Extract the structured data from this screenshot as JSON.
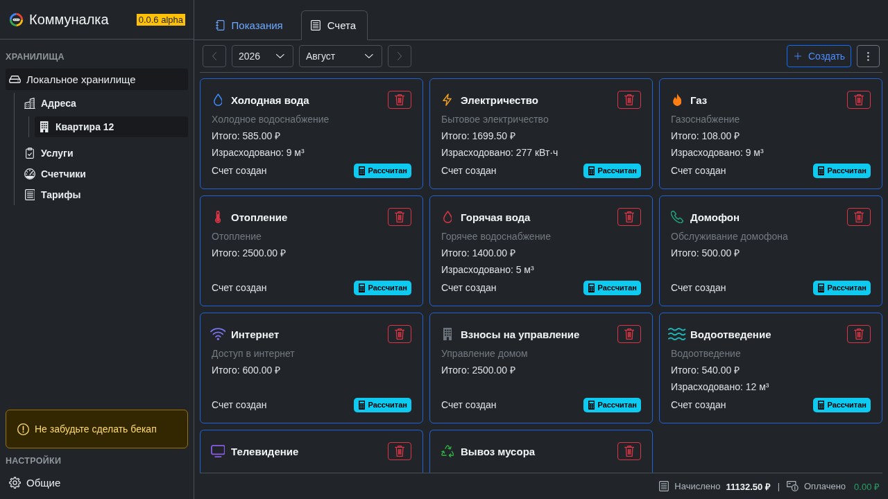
{
  "app": {
    "title": "Коммуналка",
    "version": "0.0.6 alpha"
  },
  "sidebar": {
    "storage_heading": "ХРАНИЛИЩА",
    "tree": [
      {
        "label": "Локальное хранилище",
        "kind": "storage",
        "selected": true,
        "children": [
          {
            "label": "Адреса",
            "kind": "addresses",
            "selected": false,
            "children": [
              {
                "label": "Квартира 12",
                "kind": "apartment",
                "selected": true
              }
            ]
          },
          {
            "label": "Услуги",
            "kind": "services",
            "selected": false
          },
          {
            "label": "Счетчики",
            "kind": "meters",
            "selected": false
          },
          {
            "label": "Тарифы",
            "kind": "tariffs",
            "selected": false
          }
        ]
      }
    ],
    "alert": "Не забудьте сделать бекап",
    "settings_heading": "НАСТРОЙКИ",
    "settings_items": [
      {
        "label": "Общие",
        "kind": "general",
        "selected": false
      }
    ]
  },
  "tabs": [
    {
      "label": "Показания",
      "kind": "readings",
      "selected": false
    },
    {
      "label": "Счета",
      "kind": "bills",
      "selected": true
    }
  ],
  "toolbar": {
    "year": "2026",
    "month": "Август",
    "create_label": "Создать"
  },
  "bills": [
    {
      "kind": "water",
      "color": "#3d8bfd",
      "title": "Холодная вода",
      "service": "Холодное водоснабжение",
      "total": "Итого: 585.00 ₽",
      "consumed": "Израсходовано: 9 м³",
      "status": "Счет создан",
      "badge": "Рассчитан"
    },
    {
      "kind": "electricity",
      "color": "#f0a020",
      "title": "Электричество",
      "service": "Бытовое электричество",
      "total": "Итого: 1699.50 ₽",
      "consumed": "Израсходовано: 277 кВт·ч",
      "status": "Счет создан",
      "badge": "Рассчитан"
    },
    {
      "kind": "gas",
      "color": "#fd7e14",
      "title": "Газ",
      "service": "Газоснабжение",
      "total": "Итого: 108.00 ₽",
      "consumed": "Израсходовано: 9 м³",
      "status": "Счет создан",
      "badge": "Рассчитан"
    },
    {
      "kind": "heating",
      "color": "#dc3545",
      "title": "Отопление",
      "service": "Отопление",
      "total": "Итого: 2500.00 ₽",
      "status": "Счет создан",
      "badge": "Рассчитан"
    },
    {
      "kind": "water",
      "color": "#dc3545",
      "title": "Горячая вода",
      "service": "Горячее водоснабжение",
      "total": "Итого: 1400.00 ₽",
      "consumed": "Израсходовано: 5 м³",
      "status": "Счет создан",
      "badge": "Рассчитан"
    },
    {
      "kind": "intercom",
      "color": "#20a27e",
      "title": "Домофон",
      "service": "Обслуживание домофона",
      "total": "Итого: 500.00 ₽",
      "status": "Счет создан",
      "badge": "Рассчитан"
    },
    {
      "kind": "internet",
      "color": "#7b74f0",
      "title": "Интернет",
      "service": "Доступ в интернет",
      "total": "Итого: 600.00 ₽",
      "status": "Счет создан",
      "badge": "Рассчитан"
    },
    {
      "kind": "management",
      "color": "#6c757d",
      "title": "Взносы на управление",
      "service": "Управление домом",
      "total": "Итого: 2500.00 ₽",
      "status": "Счет создан",
      "badge": "Рассчитан"
    },
    {
      "kind": "sewage",
      "color": "#1fb5b5",
      "title": "Водоотведение",
      "service": "Водоотведение",
      "total": "Итого: 540.00 ₽",
      "consumed": "Израсходовано: 12 м³",
      "status": "Счет создан",
      "badge": "Рассчитан"
    },
    {
      "kind": "tv",
      "color": "#8a5ce6",
      "title": "Телевидение"
    },
    {
      "kind": "garbage",
      "color": "#2fb344",
      "title": "Вывоз мусора"
    }
  ],
  "summary": {
    "accrued_label": "Начислено",
    "accrued": "11132.50 ₽",
    "separator": "|",
    "paid_label": "Оплачено",
    "paid": "0.00 ₽"
  }
}
